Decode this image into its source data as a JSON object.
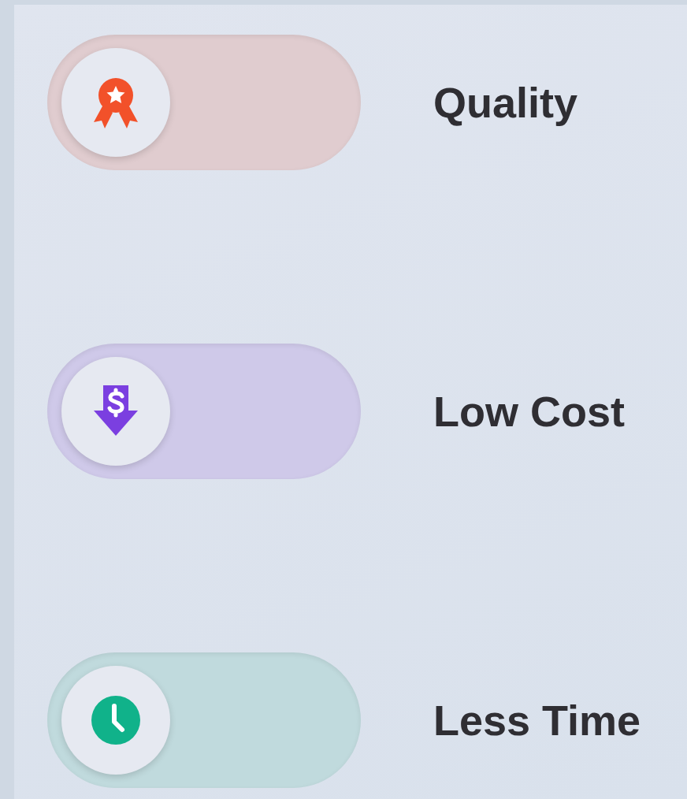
{
  "toggles": [
    {
      "kind": "award",
      "label": "Quality",
      "on": false,
      "color": "#f2512a"
    },
    {
      "kind": "price-drop",
      "label": "Low Cost",
      "on": false,
      "color": "#7b3fe0"
    },
    {
      "kind": "clock",
      "label": "Less Time",
      "on": false,
      "color": "#10b28a"
    }
  ]
}
